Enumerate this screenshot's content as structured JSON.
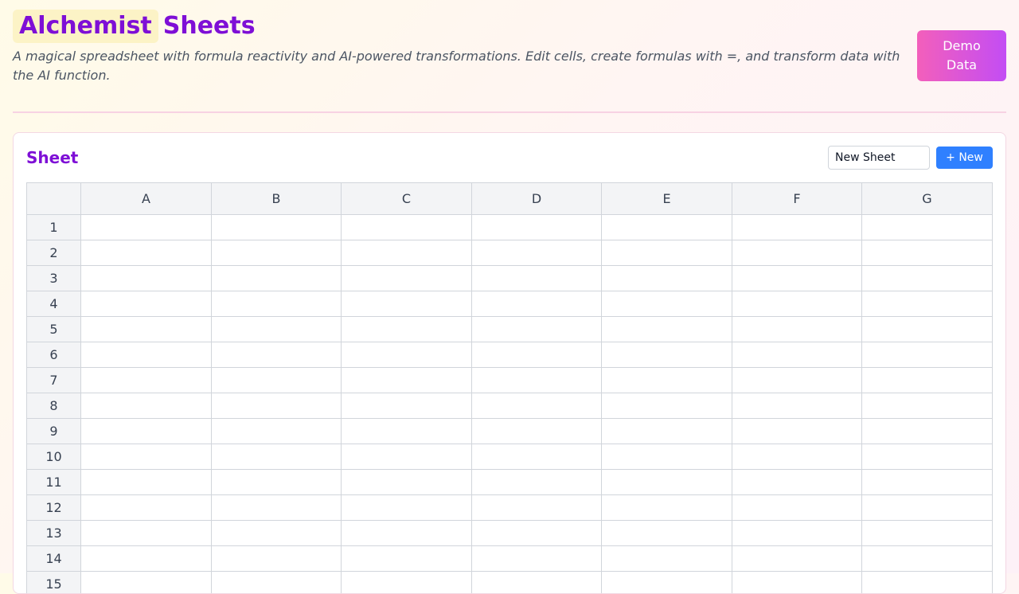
{
  "header": {
    "title_highlight": "Alchemist",
    "title_rest": "Sheets",
    "subtitle": "A magical spreadsheet with formula reactivity and AI-powered transformations. Edit cells, create formulas with =, and transform data with the AI function.",
    "demo_button": "Demo Data"
  },
  "sheet": {
    "title": "Sheet",
    "name_input_value": "New Sheet",
    "new_button": "+ New",
    "columns": [
      "A",
      "B",
      "C",
      "D",
      "E",
      "F",
      "G"
    ],
    "rows": [
      "1",
      "2",
      "3",
      "4",
      "5",
      "6",
      "7",
      "8",
      "9",
      "10",
      "11",
      "12",
      "13",
      "14",
      "15"
    ]
  },
  "colors": {
    "accent": "#7e0fd6",
    "primary_button": "#2f80ff",
    "demo_gradient_start": "#f35fbb",
    "demo_gradient_end": "#c34df4"
  }
}
